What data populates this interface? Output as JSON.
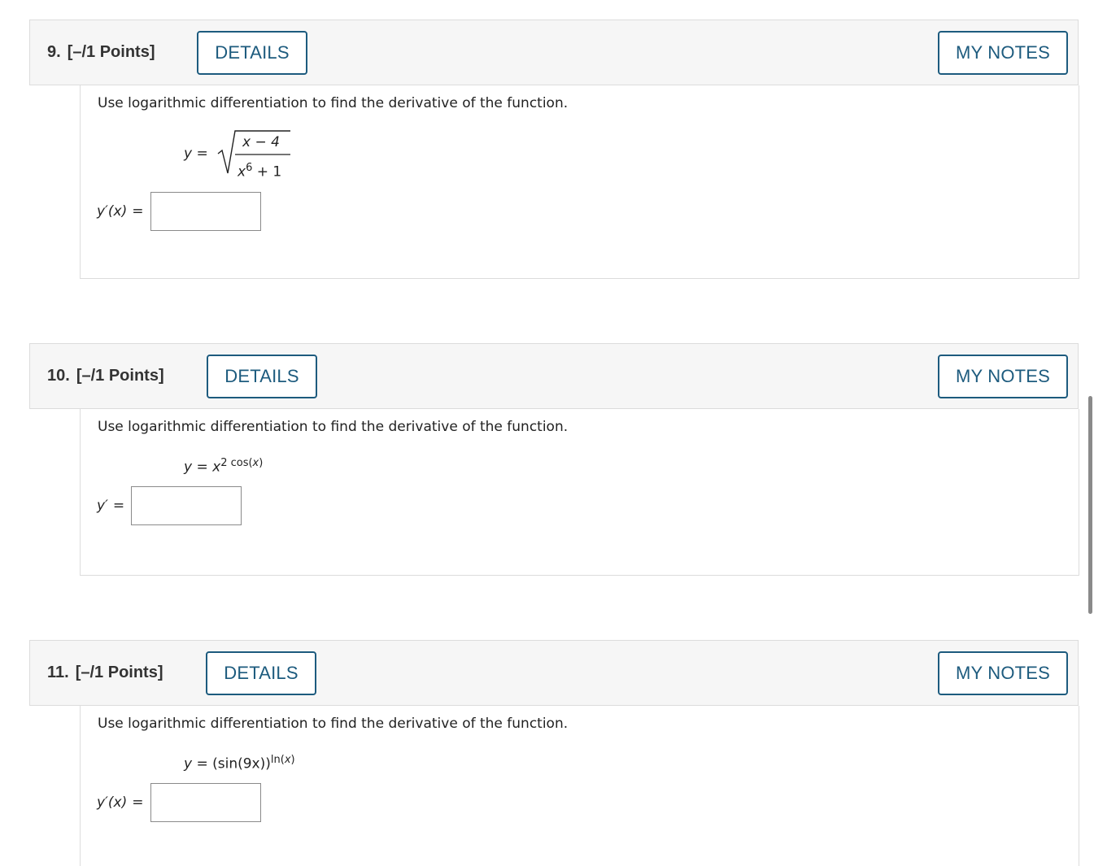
{
  "questions": [
    {
      "number": "9.",
      "points": "[–/1 Points]",
      "details_label": "DETAILS",
      "notes_label": "MY NOTES",
      "prompt": "Use logarithmic differentiation to find the derivative of the function.",
      "function_lhs": "y =",
      "numerator": "x − 4",
      "denominator_base": "x",
      "denominator_exp": "6",
      "denominator_rest": " + 1",
      "answer_label": "y′(x)",
      "answer_eq": "=",
      "answer_value": ""
    },
    {
      "number": "10.",
      "points": "[–/1 Points]",
      "details_label": "DETAILS",
      "notes_label": "MY NOTES",
      "prompt": "Use logarithmic differentiation to find the derivative of the function.",
      "function_lhs": "y = x",
      "exponent_num": "2 ",
      "exponent_fn": "cos(",
      "exponent_var": "x",
      "exponent_close": ")",
      "answer_label": "y′",
      "answer_eq": "=",
      "answer_value": ""
    },
    {
      "number": "11.",
      "points": "[–/1 Points]",
      "details_label": "DETAILS",
      "notes_label": "MY NOTES",
      "prompt": "Use logarithmic differentiation to find the derivative of the function.",
      "function_lhs": "y =",
      "function_base": " (sin(9x))",
      "exponent_fn": "ln(",
      "exponent_var": "x",
      "exponent_close": ")",
      "answer_label": "y′(x)",
      "answer_eq": "=",
      "answer_value": ""
    }
  ]
}
